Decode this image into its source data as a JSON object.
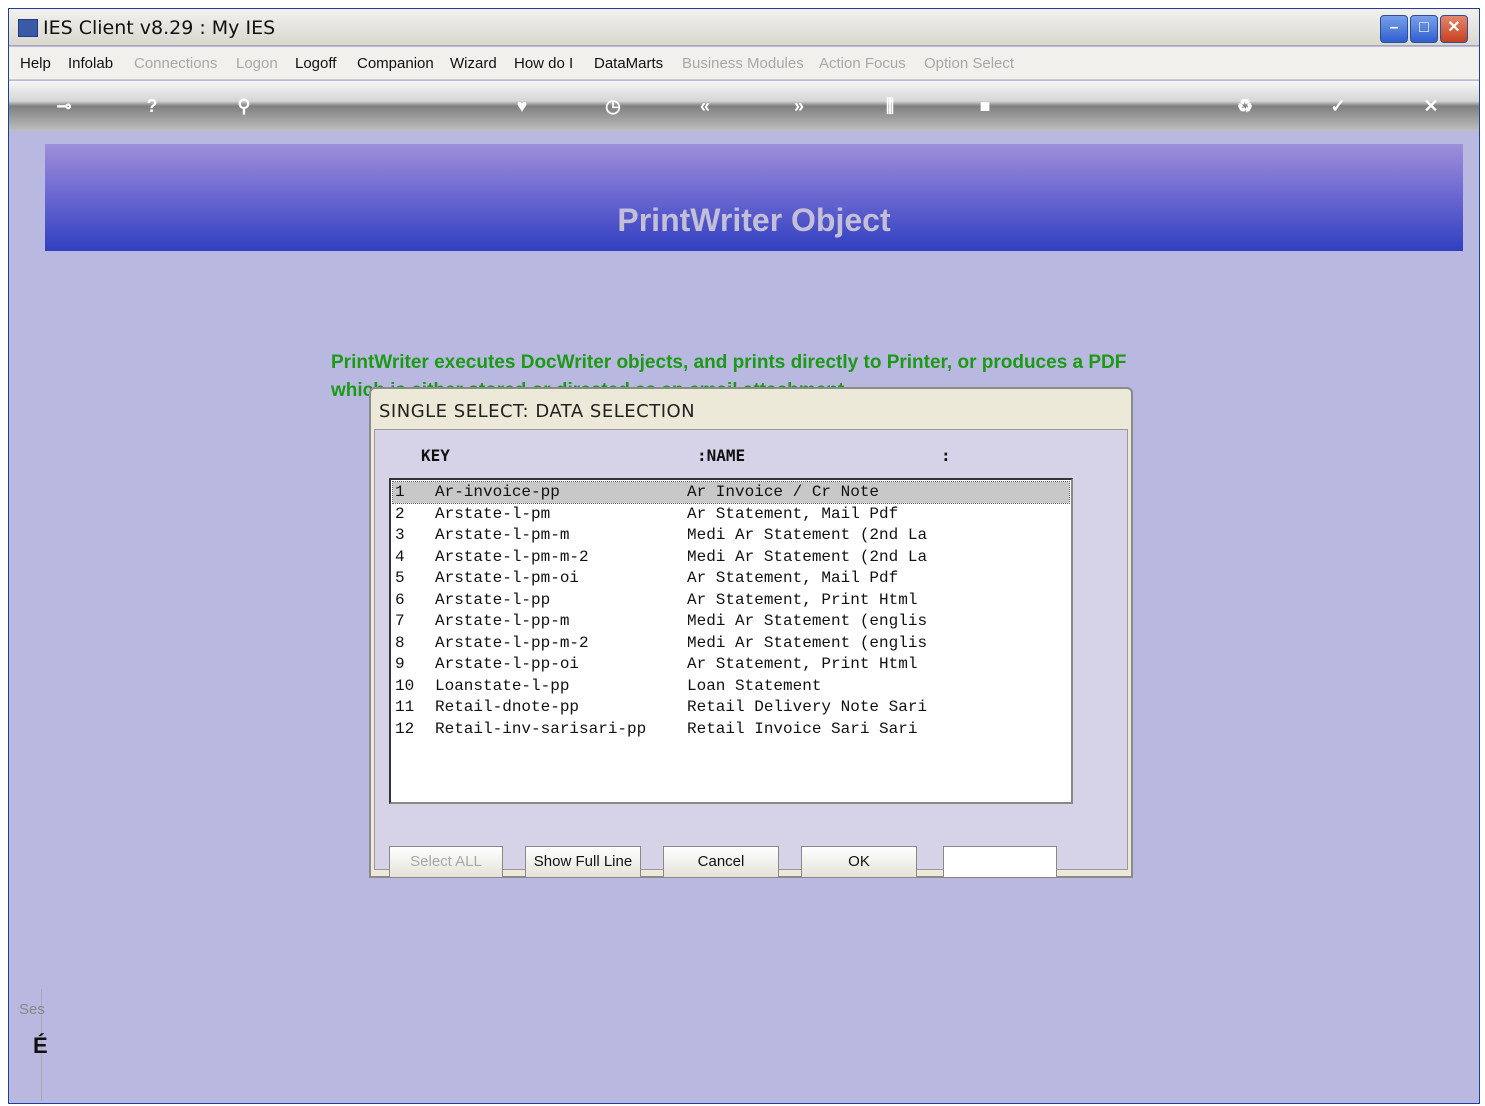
{
  "window": {
    "title": "IES Client v8.29 : My IES",
    "min": "–",
    "max": "□",
    "close": "✕"
  },
  "menu": [
    {
      "label": "Help",
      "disabled": false
    },
    {
      "label": "Infolab",
      "disabled": false
    },
    {
      "label": "Connections",
      "disabled": true
    },
    {
      "label": "Logon",
      "disabled": true
    },
    {
      "label": "Logoff",
      "disabled": false
    },
    {
      "label": "Companion",
      "disabled": false
    },
    {
      "label": "Wizard",
      "disabled": false
    },
    {
      "label": "How do I",
      "disabled": false
    },
    {
      "label": "DataMarts",
      "disabled": false
    },
    {
      "label": "Business Modules",
      "disabled": true
    },
    {
      "label": "Action Focus",
      "disabled": true
    },
    {
      "label": "Option Select",
      "disabled": true
    }
  ],
  "toolbar_icons": [
    "key-icon",
    "help-icon",
    "search-icon",
    "heart-icon",
    "clock-icon",
    "back-icon",
    "forward-icon",
    "columns-icon",
    "stop-icon",
    "recycle-icon",
    "check-icon",
    "close-icon"
  ],
  "banner": {
    "title": "PrintWriter Object"
  },
  "help_text": "PrintWriter executes DocWriter objects, and  prints directly to Printer, or produces a PDF which is either stored or directed as an email attachment.",
  "dialog": {
    "title": "SINGLE SELECT: DATA SELECTION",
    "header_key": "KEY",
    "header_name": ":NAME",
    "header_colon": ":",
    "rows": [
      {
        "n": "1",
        "key": "Ar-invoice-pp",
        "name": "Ar Invoice / Cr Note"
      },
      {
        "n": "2",
        "key": "Arstate-l-pm",
        "name": "Ar Statement, Mail Pdf"
      },
      {
        "n": "3",
        "key": "Arstate-l-pm-m",
        "name": "Medi Ar Statement (2nd La"
      },
      {
        "n": "4",
        "key": "Arstate-l-pm-m-2",
        "name": "Medi Ar Statement (2nd La"
      },
      {
        "n": "5",
        "key": "Arstate-l-pm-oi",
        "name": "Ar Statement, Mail Pdf"
      },
      {
        "n": "6",
        "key": "Arstate-l-pp",
        "name": "Ar Statement, Print Html"
      },
      {
        "n": "7",
        "key": "Arstate-l-pp-m",
        "name": "Medi Ar Statement (englis"
      },
      {
        "n": "8",
        "key": "Arstate-l-pp-m-2",
        "name": "Medi Ar Statement (englis"
      },
      {
        "n": "9",
        "key": "Arstate-l-pp-oi",
        "name": "Ar Statement, Print Html"
      },
      {
        "n": "10",
        "key": "Loanstate-l-pp",
        "name": "Loan Statement"
      },
      {
        "n": "11",
        "key": "Retail-dnote-pp",
        "name": "Retail Delivery Note Sari"
      },
      {
        "n": "12",
        "key": "Retail-inv-sarisari-pp",
        "name": "Retail Invoice Sari Sari"
      }
    ],
    "selected_row": 1,
    "buttons": {
      "select_all": "Select ALL",
      "show_full_line": "Show Full Line",
      "cancel": "Cancel",
      "ok": "OK"
    },
    "input_value": ""
  },
  "status": {
    "label": "Ses",
    "icon": "É"
  }
}
